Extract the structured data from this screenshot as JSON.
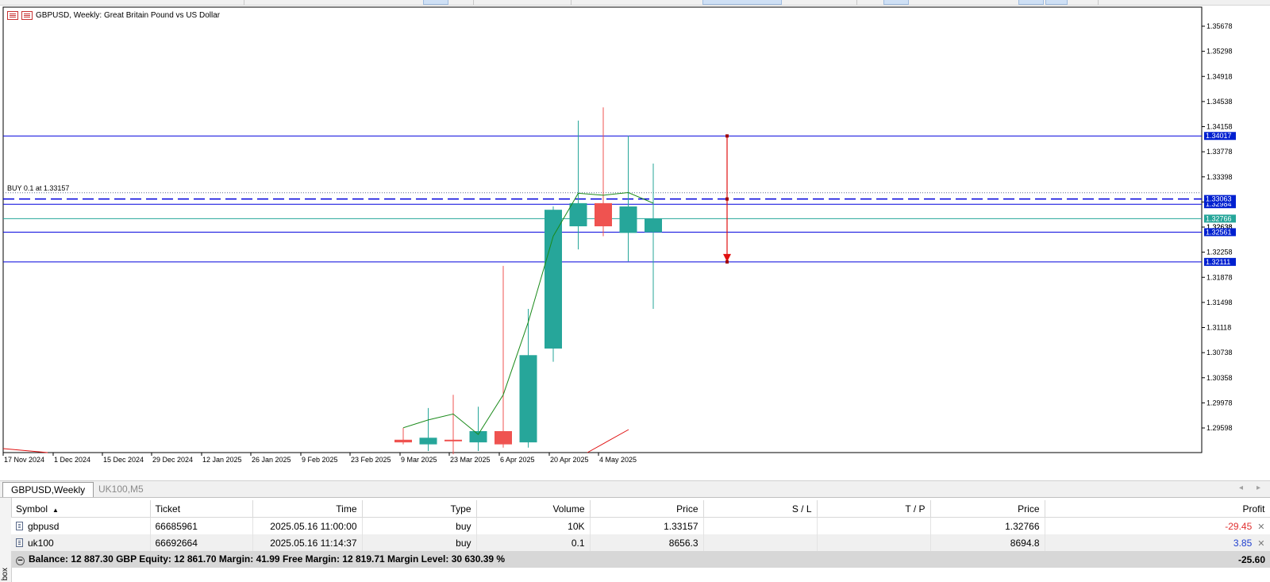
{
  "chart": {
    "title": "GBPUSD, Weekly:  Great Britain Pound vs US Dollar",
    "order_label": "BUY 0.1 at 1.33157"
  },
  "colors": {
    "bull": "#26a69a",
    "bear": "#ef5350",
    "hline": "#0000dd",
    "ma": "#1a8a1a",
    "arrow": "#e01010",
    "tp_label_bg": "#26a69a"
  },
  "chart_data": {
    "type": "candlestick",
    "symbol": "GBPUSD",
    "timeframe": "Weekly",
    "y_ticks": [
      1.35678,
      1.35298,
      1.34918,
      1.34538,
      1.34158,
      1.33778,
      1.33398,
      1.33018,
      1.32638,
      1.32258,
      1.31878,
      1.31498,
      1.31118,
      1.30738,
      1.30358,
      1.29978,
      1.29598
    ],
    "x_labels": [
      "17 Nov 2024",
      "1 Dec 2024",
      "15 Dec 2024",
      "29 Dec 2024",
      "12 Jan 2025",
      "26 Jan 2025",
      "9 Feb 2025",
      "23 Feb 2025",
      "9 Mar 2025",
      "23 Mar 2025",
      "6 Apr 2025",
      "20 Apr 2025",
      "4 May 2025"
    ],
    "candles": [
      {
        "week": "23 Feb 2025",
        "open": 1.2942,
        "high": 1.296,
        "low": 1.2935,
        "close": 1.2938
      },
      {
        "week": "2 Mar 2025",
        "open": 1.2935,
        "high": 1.299,
        "low": 1.2925,
        "close": 1.2945
      },
      {
        "week": "9 Mar 2025",
        "open": 1.2942,
        "high": 1.301,
        "low": 1.292,
        "close": 1.294
      },
      {
        "week": "16 Mar 2025",
        "open": 1.2938,
        "high": 1.2992,
        "low": 1.2925,
        "close": 1.2955
      },
      {
        "week": "23 Mar 2025",
        "open": 1.2955,
        "high": 1.3205,
        "low": 1.293,
        "close": 1.2935
      },
      {
        "week": "30 Mar 2025",
        "open": 1.2938,
        "high": 1.314,
        "low": 1.293,
        "close": 1.307
      },
      {
        "week": "6 Apr 2025",
        "open": 1.308,
        "high": 1.3295,
        "low": 1.306,
        "close": 1.329
      },
      {
        "week": "13 Apr 2025",
        "open": 1.3265,
        "high": 1.3425,
        "low": 1.323,
        "close": 1.33
      },
      {
        "week": "20 Apr 2025",
        "open": 1.33,
        "high": 1.3445,
        "low": 1.325,
        "close": 1.3265
      },
      {
        "week": "27 Apr 2025",
        "open": 1.3255,
        "high": 1.3402,
        "low": 1.3212,
        "close": 1.3295
      },
      {
        "week": "4 May 2025",
        "open": 1.3256,
        "high": 1.336,
        "low": 1.314,
        "close": 1.32766
      }
    ],
    "ma_line": [
      1.296,
      1.2972,
      1.2981,
      1.295,
      1.301,
      1.312,
      1.325,
      1.3315,
      1.3312,
      1.3316,
      1.33
    ],
    "h_lines": [
      {
        "price": 1.34017,
        "label": "1.34017"
      },
      {
        "price": 1.32984,
        "label": "1.32984"
      },
      {
        "price": 1.32561,
        "label": "1.32561"
      },
      {
        "price": 1.32111,
        "label": "1.32111"
      }
    ],
    "dashed_line": {
      "price": 1.33063,
      "label": "1.33063"
    },
    "order_line": {
      "price": 1.33157
    },
    "current_price": {
      "price": 1.32766,
      "label": "1.32766"
    },
    "hidden_tick_label": "1.32638",
    "arrow": {
      "from": 1.34017,
      "to": 1.32111
    }
  },
  "tabs": [
    "GBPUSD,Weekly",
    "UK100,M5"
  ],
  "terminal": {
    "side_label": "box",
    "columns": [
      "Symbol",
      "Ticket",
      "Time",
      "Type",
      "Volume",
      "Price",
      "S / L",
      "T / P",
      "Price",
      "Profit"
    ],
    "rows": [
      {
        "symbol": "gbpusd",
        "ticket": "66685961",
        "time": "2025.05.16 11:00:00",
        "type": "buy",
        "volume": "10K",
        "price": "1.33157",
        "sl": "",
        "tp": "",
        "cur_price": "1.32766",
        "profit": "-29.45"
      },
      {
        "symbol": "uk100",
        "ticket": "66692664",
        "time": "2025.05.16 11:14:37",
        "type": "buy",
        "volume": "0.1",
        "price": "8656.3",
        "sl": "",
        "tp": "",
        "cur_price": "8694.8",
        "profit": "3.85"
      }
    ],
    "balance_text": "Balance: 12 887.30 GBP  Equity: 12 861.70  Margin: 41.99  Free Margin: 12 819.71  Margin Level: 30 630.39 %",
    "total_profit": "-25.60"
  }
}
